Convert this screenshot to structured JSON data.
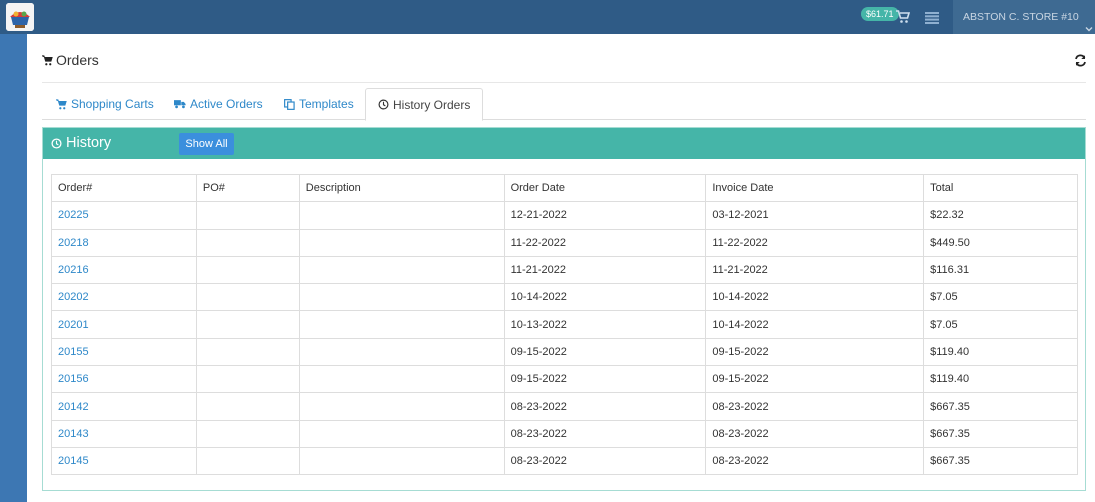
{
  "topbar": {
    "logo_icon": "store-logo",
    "cart_badge": "$61.71",
    "cart_icon": "shopping-cart-icon",
    "menu_icon": "list-menu-icon",
    "user_label": "ABSTON C. STORE #10"
  },
  "page": {
    "title": "Orders",
    "refresh_icon": "refresh-icon"
  },
  "tabs": [
    {
      "label": "Shopping Carts",
      "icon": "shopping-cart-icon",
      "active": false
    },
    {
      "label": "Active Orders",
      "icon": "truck-icon",
      "active": false
    },
    {
      "label": "Templates",
      "icon": "copy-icon",
      "active": false
    },
    {
      "label": "History Orders",
      "icon": "clock-icon",
      "active": true
    }
  ],
  "history": {
    "title": "History",
    "show_all_label": "Show All",
    "columns": [
      "Order#",
      "PO#",
      "Description",
      "Order Date",
      "Invoice Date",
      "Total"
    ],
    "rows": [
      {
        "order": "20225",
        "po": "",
        "description": "",
        "order_date": "12-21-2022",
        "invoice_date": "03-12-2021",
        "total": "$22.32"
      },
      {
        "order": "20218",
        "po": "",
        "description": "",
        "order_date": "11-22-2022",
        "invoice_date": "11-22-2022",
        "total": "$449.50"
      },
      {
        "order": "20216",
        "po": "",
        "description": "",
        "order_date": "11-21-2022",
        "invoice_date": "11-21-2022",
        "total": "$116.31"
      },
      {
        "order": "20202",
        "po": "",
        "description": "",
        "order_date": "10-14-2022",
        "invoice_date": "10-14-2022",
        "total": "$7.05"
      },
      {
        "order": "20201",
        "po": "",
        "description": "",
        "order_date": "10-13-2022",
        "invoice_date": "10-14-2022",
        "total": "$7.05"
      },
      {
        "order": "20155",
        "po": "",
        "description": "",
        "order_date": "09-15-2022",
        "invoice_date": "09-15-2022",
        "total": "$119.40"
      },
      {
        "order": "20156",
        "po": "",
        "description": "",
        "order_date": "09-15-2022",
        "invoice_date": "09-15-2022",
        "total": "$119.40"
      },
      {
        "order": "20142",
        "po": "",
        "description": "",
        "order_date": "08-23-2022",
        "invoice_date": "08-23-2022",
        "total": "$667.35"
      },
      {
        "order": "20143",
        "po": "",
        "description": "",
        "order_date": "08-23-2022",
        "invoice_date": "08-23-2022",
        "total": "$667.35"
      },
      {
        "order": "20145",
        "po": "",
        "description": "",
        "order_date": "08-23-2022",
        "invoice_date": "08-23-2022",
        "total": "$667.35"
      }
    ]
  },
  "colors": {
    "topbar": "#2f5b86",
    "leftrail": "#3d77b3",
    "panel_header": "#45b5a8",
    "link": "#2e88c9",
    "button": "#3b8fdd"
  }
}
